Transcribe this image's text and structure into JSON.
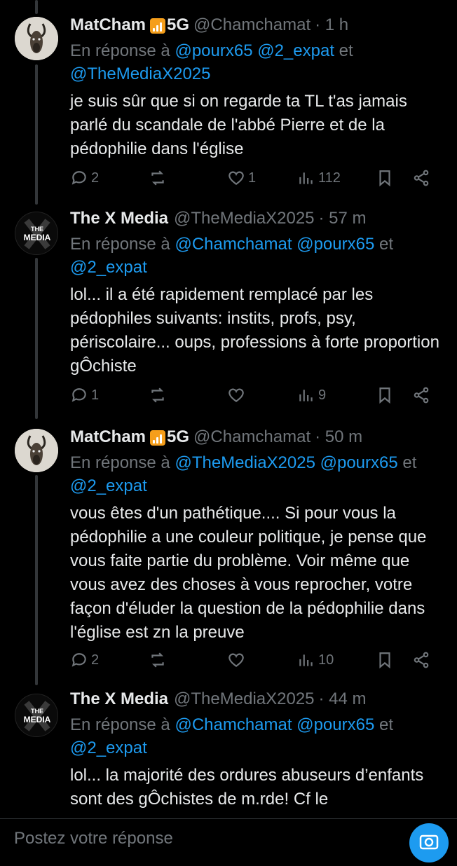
{
  "tweets": [
    {
      "name": "MatCham",
      "badge": "5G",
      "handle": "@Chamchamat",
      "time": "· 1 h",
      "reply_prefix": "En réponse à",
      "mentions": [
        "@pourx65",
        "@2_expat",
        "@TheMediaX2025"
      ],
      "reply_joiner": "et",
      "text": "je suis sûr que si on regarde ta TL t'as jamais parlé du scandale de l'abbé Pierre et de la pédophilie dans l'église",
      "replies": "2",
      "reposts": "",
      "likes": "1",
      "views": "112"
    },
    {
      "name": "The X Media",
      "badge": "",
      "handle": "@TheMediaX2025",
      "time": "· 57 m",
      "reply_prefix": "En réponse à",
      "mentions": [
        "@Chamchamat",
        "@pourx65",
        "@2_expat"
      ],
      "reply_joiner": "et",
      "text": "lol... il a été rapidement remplacé par les pédophiles suivants: instits, profs, psy, périscolaire... oups, professions à forte proportion gÔchiste",
      "replies": "1",
      "reposts": "",
      "likes": "",
      "views": "9"
    },
    {
      "name": "MatCham",
      "badge": "5G",
      "handle": "@Chamchamat",
      "time": "· 50 m",
      "reply_prefix": "En réponse à",
      "mentions": [
        "@TheMediaX2025",
        "@pourx65",
        "@2_expat"
      ],
      "reply_joiner": "et",
      "text": "vous êtes d'un pathétique.... Si pour vous la pédophilie a une couleur politique, je pense que vous faite partie du problème. Voir même que vous avez des choses à vous reprocher, votre façon d'éluder la question de la pédophilie dans l'église est zn la preuve",
      "replies": "2",
      "reposts": "",
      "likes": "",
      "views": "10"
    },
    {
      "name": "The X Media",
      "badge": "",
      "handle": "@TheMediaX2025",
      "time": "· 44 m",
      "reply_prefix": "En réponse à",
      "mentions": [
        "@Chamchamat",
        "@pourx65",
        "@2_expat"
      ],
      "reply_joiner": "et",
      "text": "lol... la majorité des ordures abuseurs d’enfants sont des gÔchistes de m.rde! Cf le",
      "replies": "",
      "reposts": "",
      "likes": "",
      "views": ""
    }
  ],
  "avatar_media_text": [
    "THE",
    "MEDIA"
  ],
  "composer": {
    "placeholder": "Postez votre réponse"
  },
  "colors": {
    "accent": "#1d9bf0",
    "muted": "#71767b",
    "background": "#000000",
    "signal_badge": "#f59e1b"
  },
  "icons": [
    "reply-icon",
    "repost-icon",
    "like-icon",
    "views-icon",
    "bookmark-icon",
    "share-icon",
    "more-icon",
    "camera-icon",
    "signal-bars-icon"
  ]
}
